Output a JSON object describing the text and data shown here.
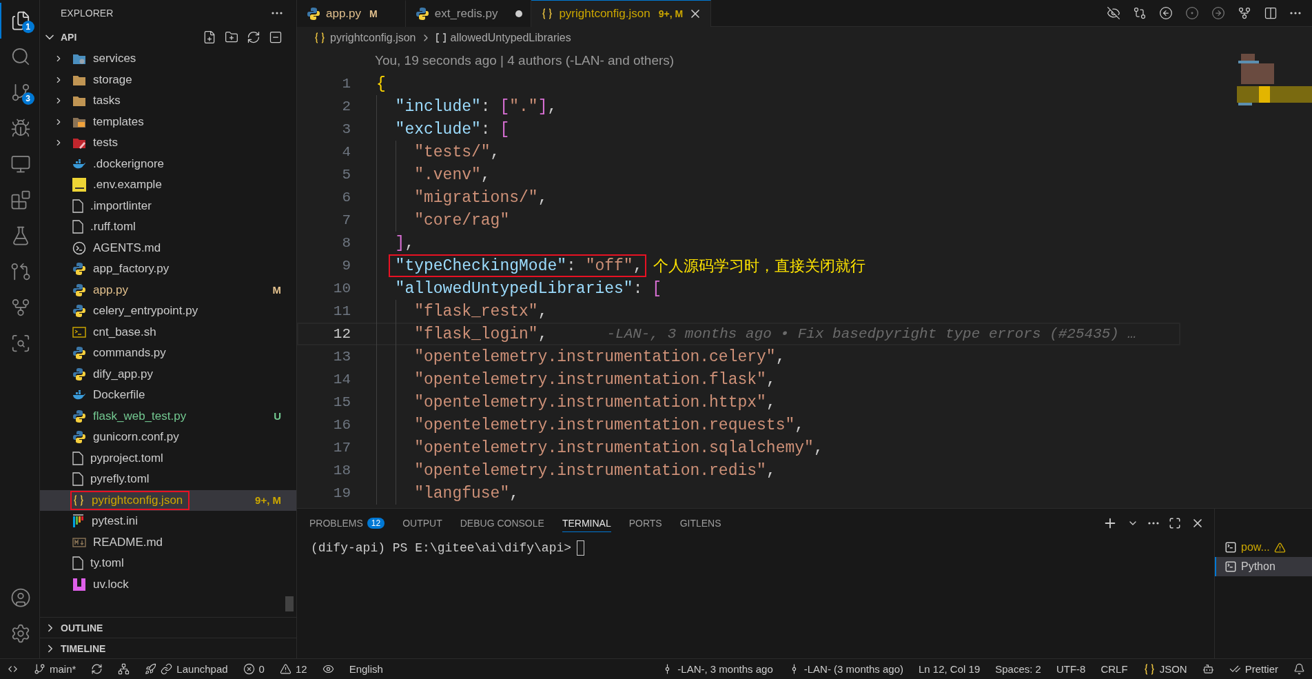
{
  "activity_bar": {
    "items": [
      {
        "kind": "explorer",
        "badge": "1",
        "selected": true
      },
      {
        "kind": "search",
        "selected": false
      },
      {
        "kind": "source-control",
        "badge": "3",
        "selected": false
      },
      {
        "kind": "debug",
        "selected": false
      },
      {
        "kind": "remote",
        "selected": false
      },
      {
        "kind": "extensions",
        "selected": false
      },
      {
        "kind": "testing",
        "selected": false
      },
      {
        "kind": "gitlens-flow",
        "selected": false
      },
      {
        "kind": "gitlens",
        "selected": false
      },
      {
        "kind": "gitlens-inspect",
        "selected": false
      }
    ],
    "bottom": [
      {
        "kind": "account"
      },
      {
        "kind": "settings"
      }
    ]
  },
  "explorer": {
    "title": "EXPLORER",
    "root": "API",
    "root_expanded": true,
    "items": [
      {
        "label": "services",
        "kind": "services-folder",
        "expanded": false,
        "selected": false,
        "boxed": false
      },
      {
        "label": "storage",
        "kind": "folder",
        "expanded": false,
        "selected": false,
        "boxed": false
      },
      {
        "label": "tasks",
        "kind": "folder",
        "expanded": false,
        "selected": false,
        "boxed": false
      },
      {
        "label": "templates",
        "kind": "templates-folder",
        "expanded": false,
        "selected": false,
        "boxed": false
      },
      {
        "label": "tests",
        "kind": "tests-folder",
        "expanded": false,
        "selected": false,
        "boxed": false
      },
      {
        "label": ".dockerignore",
        "kind": "docker",
        "selected": false,
        "boxed": false
      },
      {
        "label": ".env.example",
        "kind": "env",
        "selected": false,
        "boxed": false
      },
      {
        "label": ".importlinter",
        "kind": "plain",
        "selected": false,
        "boxed": false
      },
      {
        "label": ".ruff.toml",
        "kind": "plain",
        "selected": false,
        "boxed": false
      },
      {
        "label": "AGENTS.md",
        "kind": "agents",
        "selected": false,
        "boxed": false
      },
      {
        "label": "app_factory.py",
        "kind": "python",
        "selected": false,
        "boxed": false
      },
      {
        "label": "app.py",
        "kind": "python",
        "badge": {
          "text": "M",
          "kind": "modified"
        },
        "selected": false,
        "boxed": false
      },
      {
        "label": "celery_entrypoint.py",
        "kind": "python",
        "selected": false,
        "boxed": false
      },
      {
        "label": "cnt_base.sh",
        "kind": "shell",
        "selected": false,
        "boxed": false
      },
      {
        "label": "commands.py",
        "kind": "python",
        "selected": false,
        "boxed": false
      },
      {
        "label": "dify_app.py",
        "kind": "python",
        "selected": false,
        "boxed": false
      },
      {
        "label": "Dockerfile",
        "kind": "docker",
        "selected": false,
        "boxed": false
      },
      {
        "label": "flask_web_test.py",
        "kind": "python",
        "badge": {
          "text": "U",
          "kind": "untracked"
        },
        "selected": false,
        "boxed": false
      },
      {
        "label": "gunicorn.conf.py",
        "kind": "python",
        "selected": false,
        "boxed": false
      },
      {
        "label": "pyproject.toml",
        "kind": "plain",
        "selected": false,
        "boxed": false
      },
      {
        "label": "pyrefly.toml",
        "kind": "plain",
        "selected": false,
        "boxed": false
      },
      {
        "label": "pyrightconfig.json",
        "kind": "json",
        "badge": {
          "text": "9+, M",
          "kind": "problems"
        },
        "selected": true,
        "boxed": true
      },
      {
        "label": "pytest.ini",
        "kind": "pytest",
        "selected": false,
        "boxed": false
      },
      {
        "label": "README.md",
        "kind": "markdown",
        "selected": false,
        "boxed": false
      },
      {
        "label": "ty.toml",
        "kind": "plain",
        "selected": false,
        "boxed": false
      },
      {
        "label": "uv.lock",
        "kind": "uv",
        "selected": false,
        "boxed": false
      }
    ],
    "sections": [
      {
        "label": "OUTLINE",
        "expanded": false
      },
      {
        "label": "TIMELINE",
        "expanded": false
      }
    ]
  },
  "editor": {
    "tabs": [
      {
        "label": "app.py",
        "kind": "python",
        "badge": {
          "text": "M",
          "kind": "modified"
        },
        "dirty": false,
        "selected": false
      },
      {
        "label": "ext_redis.py",
        "kind": "python",
        "dirty": true,
        "selected": false
      },
      {
        "label": "pyrightconfig.json",
        "kind": "json",
        "badge": {
          "text": "9+, M",
          "kind": "problems"
        },
        "dirty": false,
        "selected": true
      }
    ],
    "breadcrumb": [
      {
        "label": "pyrightconfig.json",
        "kind": "file"
      },
      {
        "label": "allowedUntypedLibraries",
        "kind": "array"
      }
    ],
    "codelens": "You, 19 seconds ago | 4 authors (-LAN- and others)",
    "lines": [
      {
        "number": "1",
        "current": false,
        "boxed": false,
        "segments": [
          {
            "kind": "brace",
            "text": "{"
          }
        ]
      },
      {
        "number": "2",
        "current": false,
        "boxed": false,
        "segments": [
          {
            "kind": "indent"
          },
          {
            "kind": "key",
            "text": "\"include\""
          },
          {
            "kind": "punct",
            "text": ": "
          },
          {
            "kind": "bracket",
            "text": "["
          },
          {
            "kind": "string",
            "text": "\".\""
          },
          {
            "kind": "bracket",
            "text": "]"
          },
          {
            "kind": "punct",
            "text": ","
          }
        ]
      },
      {
        "number": "3",
        "current": false,
        "boxed": false,
        "segments": [
          {
            "kind": "indent"
          },
          {
            "kind": "key",
            "text": "\"exclude\""
          },
          {
            "kind": "punct",
            "text": ": "
          },
          {
            "kind": "bracket",
            "text": "["
          }
        ]
      },
      {
        "number": "4",
        "current": false,
        "boxed": false,
        "segments": [
          {
            "kind": "indent"
          },
          {
            "kind": "indent"
          },
          {
            "kind": "string",
            "text": "\"tests/\""
          },
          {
            "kind": "punct",
            "text": ","
          }
        ]
      },
      {
        "number": "5",
        "current": false,
        "boxed": false,
        "segments": [
          {
            "kind": "indent"
          },
          {
            "kind": "indent"
          },
          {
            "kind": "string",
            "text": "\".venv\""
          },
          {
            "kind": "punct",
            "text": ","
          }
        ]
      },
      {
        "number": "6",
        "current": false,
        "boxed": false,
        "segments": [
          {
            "kind": "indent"
          },
          {
            "kind": "indent"
          },
          {
            "kind": "string",
            "text": "\"migrations/\""
          },
          {
            "kind": "punct",
            "text": ","
          }
        ]
      },
      {
        "number": "7",
        "current": false,
        "boxed": false,
        "segments": [
          {
            "kind": "indent"
          },
          {
            "kind": "indent"
          },
          {
            "kind": "string",
            "text": "\"core/rag\""
          }
        ]
      },
      {
        "number": "8",
        "current": false,
        "boxed": false,
        "segments": [
          {
            "kind": "indent"
          },
          {
            "kind": "bracket",
            "text": "]"
          },
          {
            "kind": "punct",
            "text": ","
          }
        ]
      },
      {
        "number": "9",
        "current": false,
        "boxed": true,
        "note": "个人源码学习时，直接关闭就行",
        "segments": [
          {
            "kind": "indent"
          },
          {
            "kind": "key",
            "text": "\"typeCheckingMode\""
          },
          {
            "kind": "punct",
            "text": ": "
          },
          {
            "kind": "string",
            "text": "\"off\""
          },
          {
            "kind": "punct",
            "text": ","
          }
        ]
      },
      {
        "number": "10",
        "current": false,
        "boxed": false,
        "segments": [
          {
            "kind": "indent"
          },
          {
            "kind": "key",
            "text": "\"allowedUntypedLibraries\""
          },
          {
            "kind": "punct",
            "text": ": "
          },
          {
            "kind": "bracket",
            "text": "["
          }
        ]
      },
      {
        "number": "11",
        "current": false,
        "boxed": false,
        "segments": [
          {
            "kind": "indent"
          },
          {
            "kind": "indent"
          },
          {
            "kind": "string",
            "text": "\"flask_restx\""
          },
          {
            "kind": "punct",
            "text": ","
          }
        ]
      },
      {
        "number": "12",
        "current": true,
        "boxed": false,
        "blame": "-LAN-, 3 months ago • Fix basedpyright type errors (#25435) …",
        "segments": [
          {
            "kind": "indent"
          },
          {
            "kind": "indent"
          },
          {
            "kind": "string",
            "text": "\"flask_login\""
          },
          {
            "kind": "punct",
            "text": ","
          }
        ]
      },
      {
        "number": "13",
        "current": false,
        "boxed": false,
        "segments": [
          {
            "kind": "indent"
          },
          {
            "kind": "indent"
          },
          {
            "kind": "string",
            "text": "\"opentelemetry.instrumentation.celery\""
          },
          {
            "kind": "punct",
            "text": ","
          }
        ]
      },
      {
        "number": "14",
        "current": false,
        "boxed": false,
        "segments": [
          {
            "kind": "indent"
          },
          {
            "kind": "indent"
          },
          {
            "kind": "string",
            "text": "\"opentelemetry.instrumentation.flask\""
          },
          {
            "kind": "punct",
            "text": ","
          }
        ]
      },
      {
        "number": "15",
        "current": false,
        "boxed": false,
        "segments": [
          {
            "kind": "indent"
          },
          {
            "kind": "indent"
          },
          {
            "kind": "string",
            "text": "\"opentelemetry.instrumentation.httpx\""
          },
          {
            "kind": "punct",
            "text": ","
          }
        ]
      },
      {
        "number": "16",
        "current": false,
        "boxed": false,
        "segments": [
          {
            "kind": "indent"
          },
          {
            "kind": "indent"
          },
          {
            "kind": "string",
            "text": "\"opentelemetry.instrumentation.requests\""
          },
          {
            "kind": "punct",
            "text": ","
          }
        ]
      },
      {
        "number": "17",
        "current": false,
        "boxed": false,
        "segments": [
          {
            "kind": "indent"
          },
          {
            "kind": "indent"
          },
          {
            "kind": "string",
            "text": "\"opentelemetry.instrumentation.sqlalchemy\""
          },
          {
            "kind": "punct",
            "text": ","
          }
        ]
      },
      {
        "number": "18",
        "current": false,
        "boxed": false,
        "segments": [
          {
            "kind": "indent"
          },
          {
            "kind": "indent"
          },
          {
            "kind": "string",
            "text": "\"opentelemetry.instrumentation.redis\""
          },
          {
            "kind": "punct",
            "text": ","
          }
        ]
      },
      {
        "number": "19",
        "current": false,
        "boxed": false,
        "segments": [
          {
            "kind": "indent"
          },
          {
            "kind": "indent"
          },
          {
            "kind": "string",
            "text": "\"langfuse\""
          },
          {
            "kind": "punct",
            "text": ","
          }
        ]
      }
    ]
  },
  "panel": {
    "tabs": [
      {
        "label": "PROBLEMS",
        "badge": "12",
        "selected": false
      },
      {
        "label": "OUTPUT",
        "selected": false
      },
      {
        "label": "DEBUG CONSOLE",
        "selected": false
      },
      {
        "label": "TERMINAL",
        "selected": true
      },
      {
        "label": "PORTS",
        "selected": false
      },
      {
        "label": "GITLENS",
        "selected": false
      }
    ],
    "terminal_prompt": "(dify-api) PS E:\\gitee\\ai\\dify\\api>",
    "terminals": [
      {
        "label": "pow...",
        "warning": true,
        "selected": false
      },
      {
        "label": "Python",
        "warning": false,
        "selected": true
      }
    ]
  },
  "status_bar": {
    "left": [
      {
        "kind": "remote"
      },
      {
        "kind": "branch",
        "text": "main*"
      },
      {
        "kind": "sync"
      },
      {
        "kind": "graph"
      },
      {
        "kind": "launchpad",
        "text": "Launchpad"
      },
      {
        "kind": "errors",
        "text": "0"
      },
      {
        "kind": "warnings",
        "text": "12"
      },
      {
        "kind": "eye"
      },
      {
        "kind": "plain",
        "text": "English"
      }
    ],
    "right": [
      {
        "kind": "commit",
        "text": "-LAN-, 3 months ago"
      },
      {
        "kind": "commit",
        "text": "-LAN- (3 months ago)"
      },
      {
        "kind": "plain",
        "text": "Ln 12, Col 19"
      },
      {
        "kind": "plain",
        "text": "Spaces: 2"
      },
      {
        "kind": "plain",
        "text": "UTF-8"
      },
      {
        "kind": "plain",
        "text": "CRLF"
      },
      {
        "kind": "language",
        "text": "JSON"
      },
      {
        "kind": "copilot"
      },
      {
        "kind": "prettier",
        "text": "Prettier"
      },
      {
        "kind": "bell"
      }
    ]
  }
}
